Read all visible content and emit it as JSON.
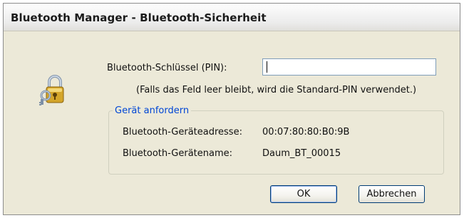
{
  "window": {
    "title": "Bluetooth Manager - Bluetooth-Sicherheit"
  },
  "icon": {
    "name": "key-lock-icon"
  },
  "pin": {
    "label": "Bluetooth-Schlüssel (PIN):",
    "value": "",
    "hint": "(Falls das Feld leer bleibt, wird die Standard-PIN verwendet.)"
  },
  "device_group": {
    "legend": "Gerät anfordern",
    "address_label": "Bluetooth-Geräteadresse:",
    "address_value": "00:07:80:80:B0:9B",
    "name_label": "Bluetooth-Gerätename:",
    "name_value": "Daum_BT_00015"
  },
  "buttons": {
    "ok": "OK",
    "cancel": "Abbrechen"
  },
  "colors": {
    "dialog_bg": "#ece9d8",
    "group_legend": "#0046d5",
    "button_border": "#003c74"
  }
}
